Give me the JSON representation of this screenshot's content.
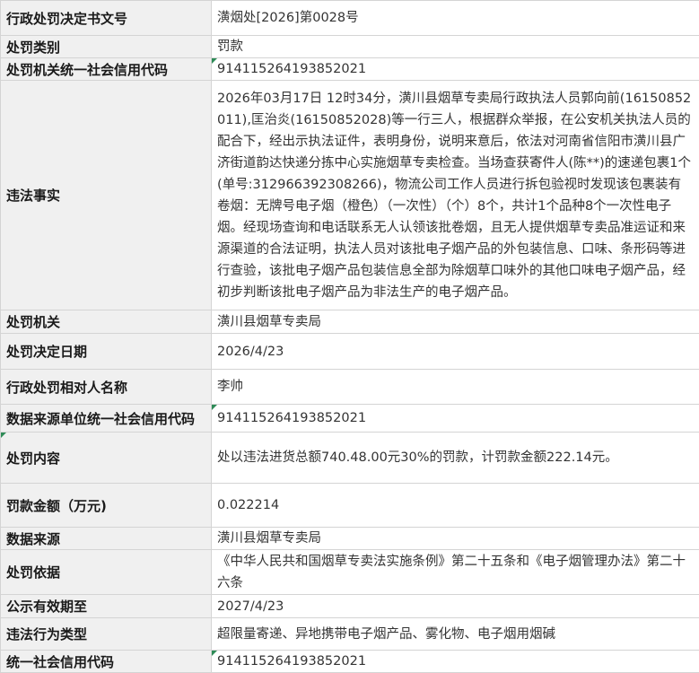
{
  "rows": [
    {
      "label": "行政处罚决定书文号",
      "value": "潢烟处[2026]第0028号"
    },
    {
      "label": "处罚类别",
      "value": "罚款"
    },
    {
      "label": "处罚机关统一社会信用代码",
      "value": "91411526419385​2021"
    },
    {
      "label": "违法事实",
      "value": "2026年03月17日 12时34分，潢川县烟草专卖局行政执法人员郭向前(16150852011),匡治炎(16150852028)等一行三人，根据群众举报，在公安机关执法人员的配合下，经出示执法证件，表明身份，说明来意后，依法对河南省信阳市潢川县广济街道韵达快递分拣中心实施烟草专卖检查。当场查获寄件人(陈**)的速递包裹1个(单号:312966392308266)，物流公司工作人员进行拆包验视时发现该包裹装有卷烟：无牌号电子烟（橙色）（一次性）（个）8个，共计1个品种8个一次性电子烟。经现场查询和电话联系无人认领该批卷烟，且无人提供烟草专卖品准运证和来源渠道的合法证明，执法人员对该批电子烟产品的外包装信息、口味、条形码等进行查验，该批电子烟产品包装信息全部为除烟草口味外的其他口味电子烟产品，经初步判断该批电子烟产品为非法生产的电子烟产品。"
    },
    {
      "label": "处罚机关",
      "value": "潢川县烟草专卖局"
    },
    {
      "label": "处罚决定日期",
      "value": "2026/4/23"
    },
    {
      "label": "行政处罚相对人名称",
      "value": "李帅"
    },
    {
      "label": "数据来源单位统一社会信用代码",
      "value": "914115264193852021"
    },
    {
      "label": "处罚内容",
      "value": "处以违法进货总额740.48.00元30%的罚款，计罚款金额222.14元。"
    },
    {
      "label": "罚款金额（万元)",
      "value": "0.022214"
    },
    {
      "label": "数据来源",
      "value": "潢川县烟草专卖局"
    },
    {
      "label": "处罚依据",
      "value": "《中华人民共和国烟草专卖法实施条例》第二十五条和《电子烟管理办法》第二十六条"
    },
    {
      "label": "公示有效期至",
      "value": "2027/4/23"
    },
    {
      "label": "违法行为类型",
      "value": "超限量寄递、异地携带电子烟产品、雾化物、电子烟用烟碱"
    },
    {
      "label": "统一社会信用代码",
      "value": "914115264193852021"
    }
  ],
  "colors": {
    "label_bg": "#f0f0f0",
    "border": "#d4d4d4",
    "corner_mark": "#2e8b57"
  }
}
